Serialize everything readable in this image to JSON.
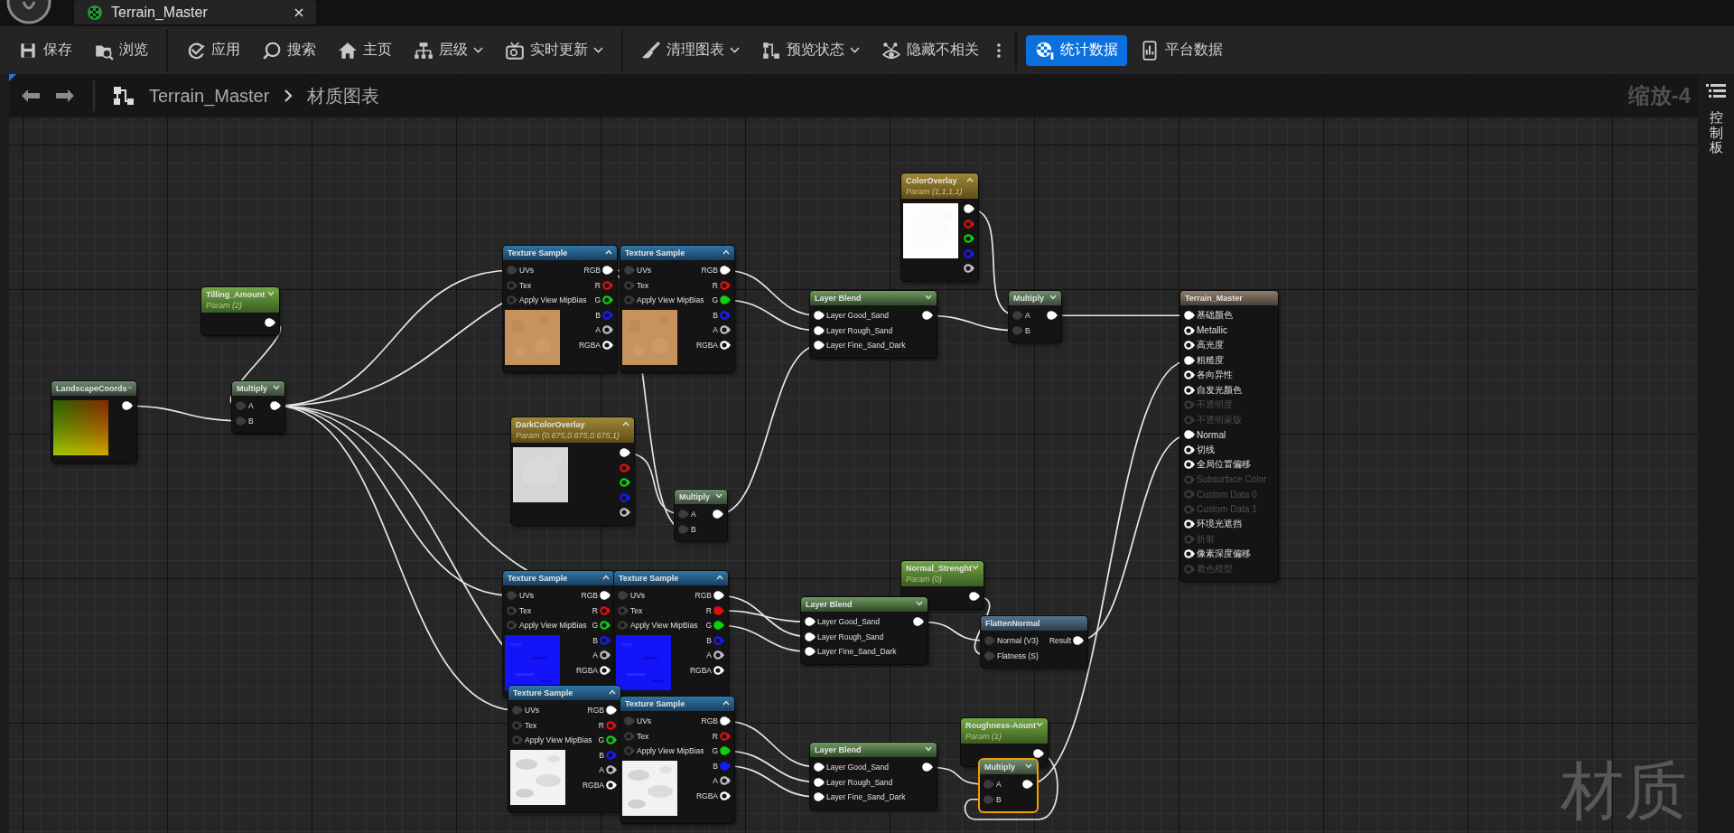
{
  "tab": {
    "title": "Terrain_Master"
  },
  "toolbar": {
    "groups": [
      {
        "items": [
          {
            "label": "保存",
            "dropdown": false,
            "selected": false
          },
          {
            "label": "浏览",
            "dropdown": false,
            "selected": false
          }
        ]
      },
      {
        "items": [
          {
            "label": "应用",
            "dropdown": false,
            "selected": false
          },
          {
            "label": "搜索",
            "dropdown": false,
            "selected": false
          },
          {
            "label": "主页",
            "dropdown": false,
            "selected": false
          },
          {
            "label": "层级",
            "dropdown": true,
            "selected": false
          },
          {
            "label": "实时更新",
            "dropdown": true,
            "selected": false
          }
        ]
      },
      {
        "items": [
          {
            "label": "清理图表",
            "dropdown": true,
            "selected": false
          },
          {
            "label": "预览状态",
            "dropdown": true,
            "selected": false
          },
          {
            "label": "隐藏不相关",
            "dropdown": false,
            "selected": false
          }
        ]
      },
      {
        "items": [
          {
            "label": "统计数据",
            "dropdown": false,
            "selected": true
          },
          {
            "label": "平台数据",
            "dropdown": false,
            "selected": false
          }
        ]
      }
    ]
  },
  "breadcrumb": {
    "asset": "Terrain_Master",
    "graph": "材质图表"
  },
  "zoom_label": "缩放-4",
  "watermark": "材质",
  "side_panel": {
    "label": "控制板"
  },
  "graph": {
    "nodes": [
      {
        "kind": "coords",
        "title": "LandscapeCoords",
        "expanded": true,
        "selected": false,
        "preview": {
          "kind": "picture"
        },
        "outputs": [
          {
            "color": "#ffffff",
            "connected": true
          }
        ]
      },
      {
        "kind": "scalar_param",
        "title": "Tilling_Amount",
        "subtitle": "Param (2)",
        "expanded": false,
        "selected": false,
        "outputs": [
          {
            "color": "#ffffff",
            "connected": true
          }
        ]
      },
      {
        "kind": "math",
        "title": "Multiply",
        "expanded": false,
        "selected": false,
        "inputs": [
          {
            "label": "A",
            "color": "#3c3c3c",
            "connected": true
          },
          {
            "label": "B",
            "color": "#3c3c3c",
            "connected": true
          }
        ],
        "outputs": [
          {
            "color": "#ffffff",
            "connected": true
          }
        ]
      },
      {
        "kind": "texture_sample",
        "title": "Texture Sample",
        "expanded": true,
        "selected": false,
        "preview": {
          "kind": "picture"
        },
        "inputs": [
          {
            "label": "UVs",
            "color": "#3c3c3c",
            "connected": true
          },
          {
            "label": "Tex",
            "color": "#3c3c3c",
            "connected": false
          },
          {
            "label": "Apply View MipBias",
            "color": "#3c3c3c",
            "connected": false
          }
        ],
        "outputs": [
          {
            "label": "RGB",
            "color": "#ffffff",
            "connected": true
          },
          {
            "label": "R",
            "color": "#e01010",
            "connected": false
          },
          {
            "label": "G",
            "color": "#10d010",
            "connected": false
          },
          {
            "label": "B",
            "color": "#1a1aff",
            "connected": false
          },
          {
            "label": "A",
            "color": "#c0c0c0",
            "connected": false
          },
          {
            "label": "RGBA",
            "color": "#ffffff",
            "connected": false
          }
        ]
      },
      {
        "kind": "texture_sample",
        "title": "Texture Sample",
        "expanded": true,
        "selected": false,
        "preview": {
          "kind": "picture"
        },
        "inputs": [
          {
            "label": "UVs",
            "color": "#3c3c3c",
            "connected": true
          },
          {
            "label": "Tex",
            "color": "#3c3c3c",
            "connected": false
          },
          {
            "label": "Apply View MipBias",
            "color": "#3c3c3c",
            "connected": false
          }
        ],
        "outputs": [
          {
            "label": "RGB",
            "color": "#ffffff",
            "connected": true
          },
          {
            "label": "R",
            "color": "#e01010",
            "connected": false
          },
          {
            "label": "G",
            "color": "#10d010",
            "connected": true
          },
          {
            "label": "B",
            "color": "#1a1aff",
            "connected": false
          },
          {
            "label": "A",
            "color": "#c0c0c0",
            "connected": false
          },
          {
            "label": "RGBA",
            "color": "#ffffff",
            "connected": false
          }
        ]
      },
      {
        "kind": "vector_param",
        "title": "ColorOverlay",
        "subtitle": "Param (1,1,1,1)",
        "expanded": true,
        "selected": false,
        "preview": {
          "kind": "picture"
        },
        "outputs": [
          {
            "color": "#ffffff",
            "connected": true
          },
          {
            "color": "#e01010",
            "connected": false
          },
          {
            "color": "#10d010",
            "connected": false
          },
          {
            "color": "#1a1aff",
            "connected": false
          },
          {
            "color": "#c0c0c0",
            "connected": false
          }
        ]
      },
      {
        "kind": "layer_blend",
        "title": "Layer Blend",
        "expanded": false,
        "selected": false,
        "inputs": [
          {
            "label": "Layer Good_Sand",
            "color": "#ffffff",
            "connected": true
          },
          {
            "label": "Layer Rough_Sand",
            "color": "#ffffff",
            "connected": true
          },
          {
            "label": "Layer Fine_Sand_Dark",
            "color": "#ffffff",
            "connected": true
          }
        ],
        "outputs": [
          {
            "color": "#ffffff",
            "connected": true
          }
        ]
      },
      {
        "kind": "math",
        "title": "Multiply",
        "expanded": false,
        "selected": false,
        "inputs": [
          {
            "label": "A",
            "color": "#3c3c3c",
            "connected": true
          },
          {
            "label": "B",
            "color": "#3c3c3c",
            "connected": true
          }
        ],
        "outputs": [
          {
            "color": "#ffffff",
            "connected": true
          }
        ]
      },
      {
        "kind": "vector_param",
        "title": "DarkColorOverlay",
        "subtitle": "Param (0.675,0.675,0.675,1)",
        "expanded": true,
        "selected": false,
        "preview": {
          "kind": "picture"
        },
        "outputs": [
          {
            "color": "#ffffff",
            "connected": true
          },
          {
            "color": "#e01010",
            "connected": false
          },
          {
            "color": "#10d010",
            "connected": false
          },
          {
            "color": "#1a1aff",
            "connected": false
          },
          {
            "color": "#c0c0c0",
            "connected": false
          }
        ]
      },
      {
        "kind": "math",
        "title": "Multiply",
        "expanded": false,
        "selected": false,
        "inputs": [
          {
            "label": "A",
            "color": "#3c3c3c",
            "connected": true
          },
          {
            "label": "B",
            "color": "#3c3c3c",
            "connected": true
          }
        ],
        "outputs": [
          {
            "color": "#ffffff",
            "connected": true
          }
        ]
      },
      {
        "kind": "texture_sample",
        "title": "Texture Sample",
        "expanded": true,
        "selected": false,
        "preview": {
          "kind": "picture"
        },
        "inputs": [
          {
            "label": "UVs",
            "color": "#3c3c3c",
            "connected": true
          },
          {
            "label": "Tex",
            "color": "#3c3c3c",
            "connected": false
          },
          {
            "label": "Apply View MipBias",
            "color": "#3c3c3c",
            "connected": false
          }
        ],
        "outputs": [
          {
            "label": "RGB",
            "color": "#ffffff",
            "connected": true
          },
          {
            "label": "R",
            "color": "#e01010",
            "connected": false
          },
          {
            "label": "G",
            "color": "#10d010",
            "connected": false
          },
          {
            "label": "B",
            "color": "#1a1aff",
            "connected": false
          },
          {
            "label": "A",
            "color": "#c0c0c0",
            "connected": false
          },
          {
            "label": "RGBA",
            "color": "#ffffff",
            "connected": false
          }
        ]
      },
      {
        "kind": "texture_sample",
        "title": "Texture Sample",
        "expanded": true,
        "selected": false,
        "preview": {
          "kind": "picture"
        },
        "inputs": [
          {
            "label": "UVs",
            "color": "#3c3c3c",
            "connected": true
          },
          {
            "label": "Tex",
            "color": "#3c3c3c",
            "connected": false
          },
          {
            "label": "Apply View MipBias",
            "color": "#3c3c3c",
            "connected": false
          }
        ],
        "outputs": [
          {
            "label": "RGB",
            "color": "#ffffff",
            "connected": true
          },
          {
            "label": "R",
            "color": "#e01010",
            "connected": true
          },
          {
            "label": "G",
            "color": "#10d010",
            "connected": true
          },
          {
            "label": "B",
            "color": "#1a1aff",
            "connected": false
          },
          {
            "label": "A",
            "color": "#c0c0c0",
            "connected": false
          },
          {
            "label": "RGBA",
            "color": "#ffffff",
            "connected": false
          }
        ]
      },
      {
        "kind": "scalar_param",
        "title": "Normal_Strenght",
        "subtitle": "Param (0)",
        "expanded": false,
        "selected": false,
        "outputs": [
          {
            "color": "#ffffff",
            "connected": true
          }
        ]
      },
      {
        "kind": "layer_blend",
        "title": "Layer Blend",
        "expanded": false,
        "selected": false,
        "inputs": [
          {
            "label": "Layer Good_Sand",
            "color": "#ffffff",
            "connected": true
          },
          {
            "label": "Layer Rough_Sand",
            "color": "#ffffff",
            "connected": true
          },
          {
            "label": "Layer Fine_Sand_Dark",
            "color": "#ffffff",
            "connected": true
          }
        ],
        "outputs": [
          {
            "color": "#ffffff",
            "connected": true
          }
        ]
      },
      {
        "kind": "function",
        "title": "FlattenNormal",
        "selected": false,
        "inputs": [
          {
            "label": "Normal (V3)",
            "color": "#3c3c3c",
            "connected": true
          },
          {
            "label": "Flatness (S)",
            "color": "#3c3c3c",
            "connected": true
          }
        ],
        "outputs": [
          {
            "label": "Result",
            "color": "#ffffff",
            "connected": true
          }
        ]
      },
      {
        "kind": "texture_sample",
        "title": "Texture Sample",
        "expanded": true,
        "selected": false,
        "preview": {
          "kind": "picture"
        },
        "inputs": [
          {
            "label": "UVs",
            "color": "#3c3c3c",
            "connected": true
          },
          {
            "label": "Tex",
            "color": "#3c3c3c",
            "connected": false
          },
          {
            "label": "Apply View MipBias",
            "color": "#3c3c3c",
            "connected": false
          }
        ],
        "outputs": [
          {
            "label": "RGB",
            "color": "#ffffff",
            "connected": true
          },
          {
            "label": "R",
            "color": "#e01010",
            "connected": false
          },
          {
            "label": "G",
            "color": "#10d010",
            "connected": false
          },
          {
            "label": "B",
            "color": "#1a1aff",
            "connected": false
          },
          {
            "label": "A",
            "color": "#c0c0c0",
            "connected": false
          },
          {
            "label": "RGBA",
            "color": "#ffffff",
            "connected": false
          }
        ]
      },
      {
        "kind": "texture_sample",
        "title": "Texture Sample",
        "expanded": true,
        "selected": false,
        "preview": {
          "kind": "picture"
        },
        "inputs": [
          {
            "label": "UVs",
            "color": "#3c3c3c",
            "connected": true
          },
          {
            "label": "Tex",
            "color": "#3c3c3c",
            "connected": false
          },
          {
            "label": "Apply View MipBias",
            "color": "#3c3c3c",
            "connected": false
          }
        ],
        "outputs": [
          {
            "label": "RGB",
            "color": "#ffffff",
            "connected": true
          },
          {
            "label": "R",
            "color": "#e01010",
            "connected": false
          },
          {
            "label": "G",
            "color": "#10d010",
            "connected": true
          },
          {
            "label": "B",
            "color": "#1a1aff",
            "connected": true
          },
          {
            "label": "A",
            "color": "#c0c0c0",
            "connected": false
          },
          {
            "label": "RGBA",
            "color": "#ffffff",
            "connected": false
          }
        ]
      },
      {
        "kind": "scalar_param",
        "title": "Roughness-Aount",
        "subtitle": "Param (1)",
        "expanded": false,
        "selected": false,
        "outputs": [
          {
            "color": "#ffffff",
            "connected": true
          }
        ]
      },
      {
        "kind": "layer_blend",
        "title": "Layer Blend",
        "expanded": false,
        "selected": false,
        "inputs": [
          {
            "label": "Layer Good_Sand",
            "color": "#ffffff",
            "connected": true
          },
          {
            "label": "Layer Rough_Sand",
            "color": "#ffffff",
            "connected": true
          },
          {
            "label": "Layer Fine_Sand_Dark",
            "color": "#ffffff",
            "connected": true
          }
        ],
        "outputs": [
          {
            "color": "#ffffff",
            "connected": true
          }
        ]
      },
      {
        "kind": "math",
        "title": "Multiply",
        "expanded": false,
        "selected": true,
        "inputs": [
          {
            "label": "A",
            "color": "#3c3c3c",
            "connected": true
          },
          {
            "label": "B",
            "color": "#3c3c3c",
            "connected": true
          }
        ],
        "outputs": [
          {
            "color": "#ffffff",
            "connected": true
          }
        ]
      },
      {
        "kind": "material_result",
        "title": "Terrain_Master",
        "selected": false,
        "inputs": [
          {
            "label": "基础颜色",
            "color": "#ffffff",
            "connected": true,
            "disabled": false
          },
          {
            "label": "Metallic",
            "color": "#ffffff",
            "connected": false,
            "disabled": false
          },
          {
            "label": "高光度",
            "color": "#ffffff",
            "connected": false,
            "disabled": false
          },
          {
            "label": "粗糙度",
            "color": "#ffffff",
            "connected": true,
            "disabled": false
          },
          {
            "label": "各向异性",
            "color": "#ffffff",
            "connected": false,
            "disabled": false
          },
          {
            "label": "自发光颜色",
            "color": "#ffffff",
            "connected": false,
            "disabled": false
          },
          {
            "label": "不透明度",
            "color": "#3a3a3a",
            "connected": false,
            "disabled": true
          },
          {
            "label": "不透明蒙版",
            "color": "#3a3a3a",
            "connected": false,
            "disabled": true
          },
          {
            "label": "Normal",
            "color": "#ffffff",
            "connected": true,
            "disabled": false
          },
          {
            "label": "切线",
            "color": "#ffffff",
            "connected": false,
            "disabled": false
          },
          {
            "label": "全局位置偏移",
            "color": "#ffffff",
            "connected": false,
            "disabled": false
          },
          {
            "label": "Subsurface Color",
            "color": "#3a3a3a",
            "connected": false,
            "disabled": true
          },
          {
            "label": "Custom Data 0",
            "color": "#3a3a3a",
            "connected": false,
            "disabled": true
          },
          {
            "label": "Custom Data 1",
            "color": "#3a3a3a",
            "connected": false,
            "disabled": true
          },
          {
            "label": "环境光遮挡",
            "color": "#ffffff",
            "connected": false,
            "disabled": false
          },
          {
            "label": "折射",
            "color": "#3a3a3a",
            "connected": false,
            "disabled": true
          },
          {
            "label": "像素深度偏移",
            "color": "#ffffff",
            "connected": false,
            "disabled": false
          },
          {
            "label": "着色模型",
            "color": "#3a3a3a",
            "connected": false,
            "disabled": true
          }
        ]
      }
    ]
  }
}
